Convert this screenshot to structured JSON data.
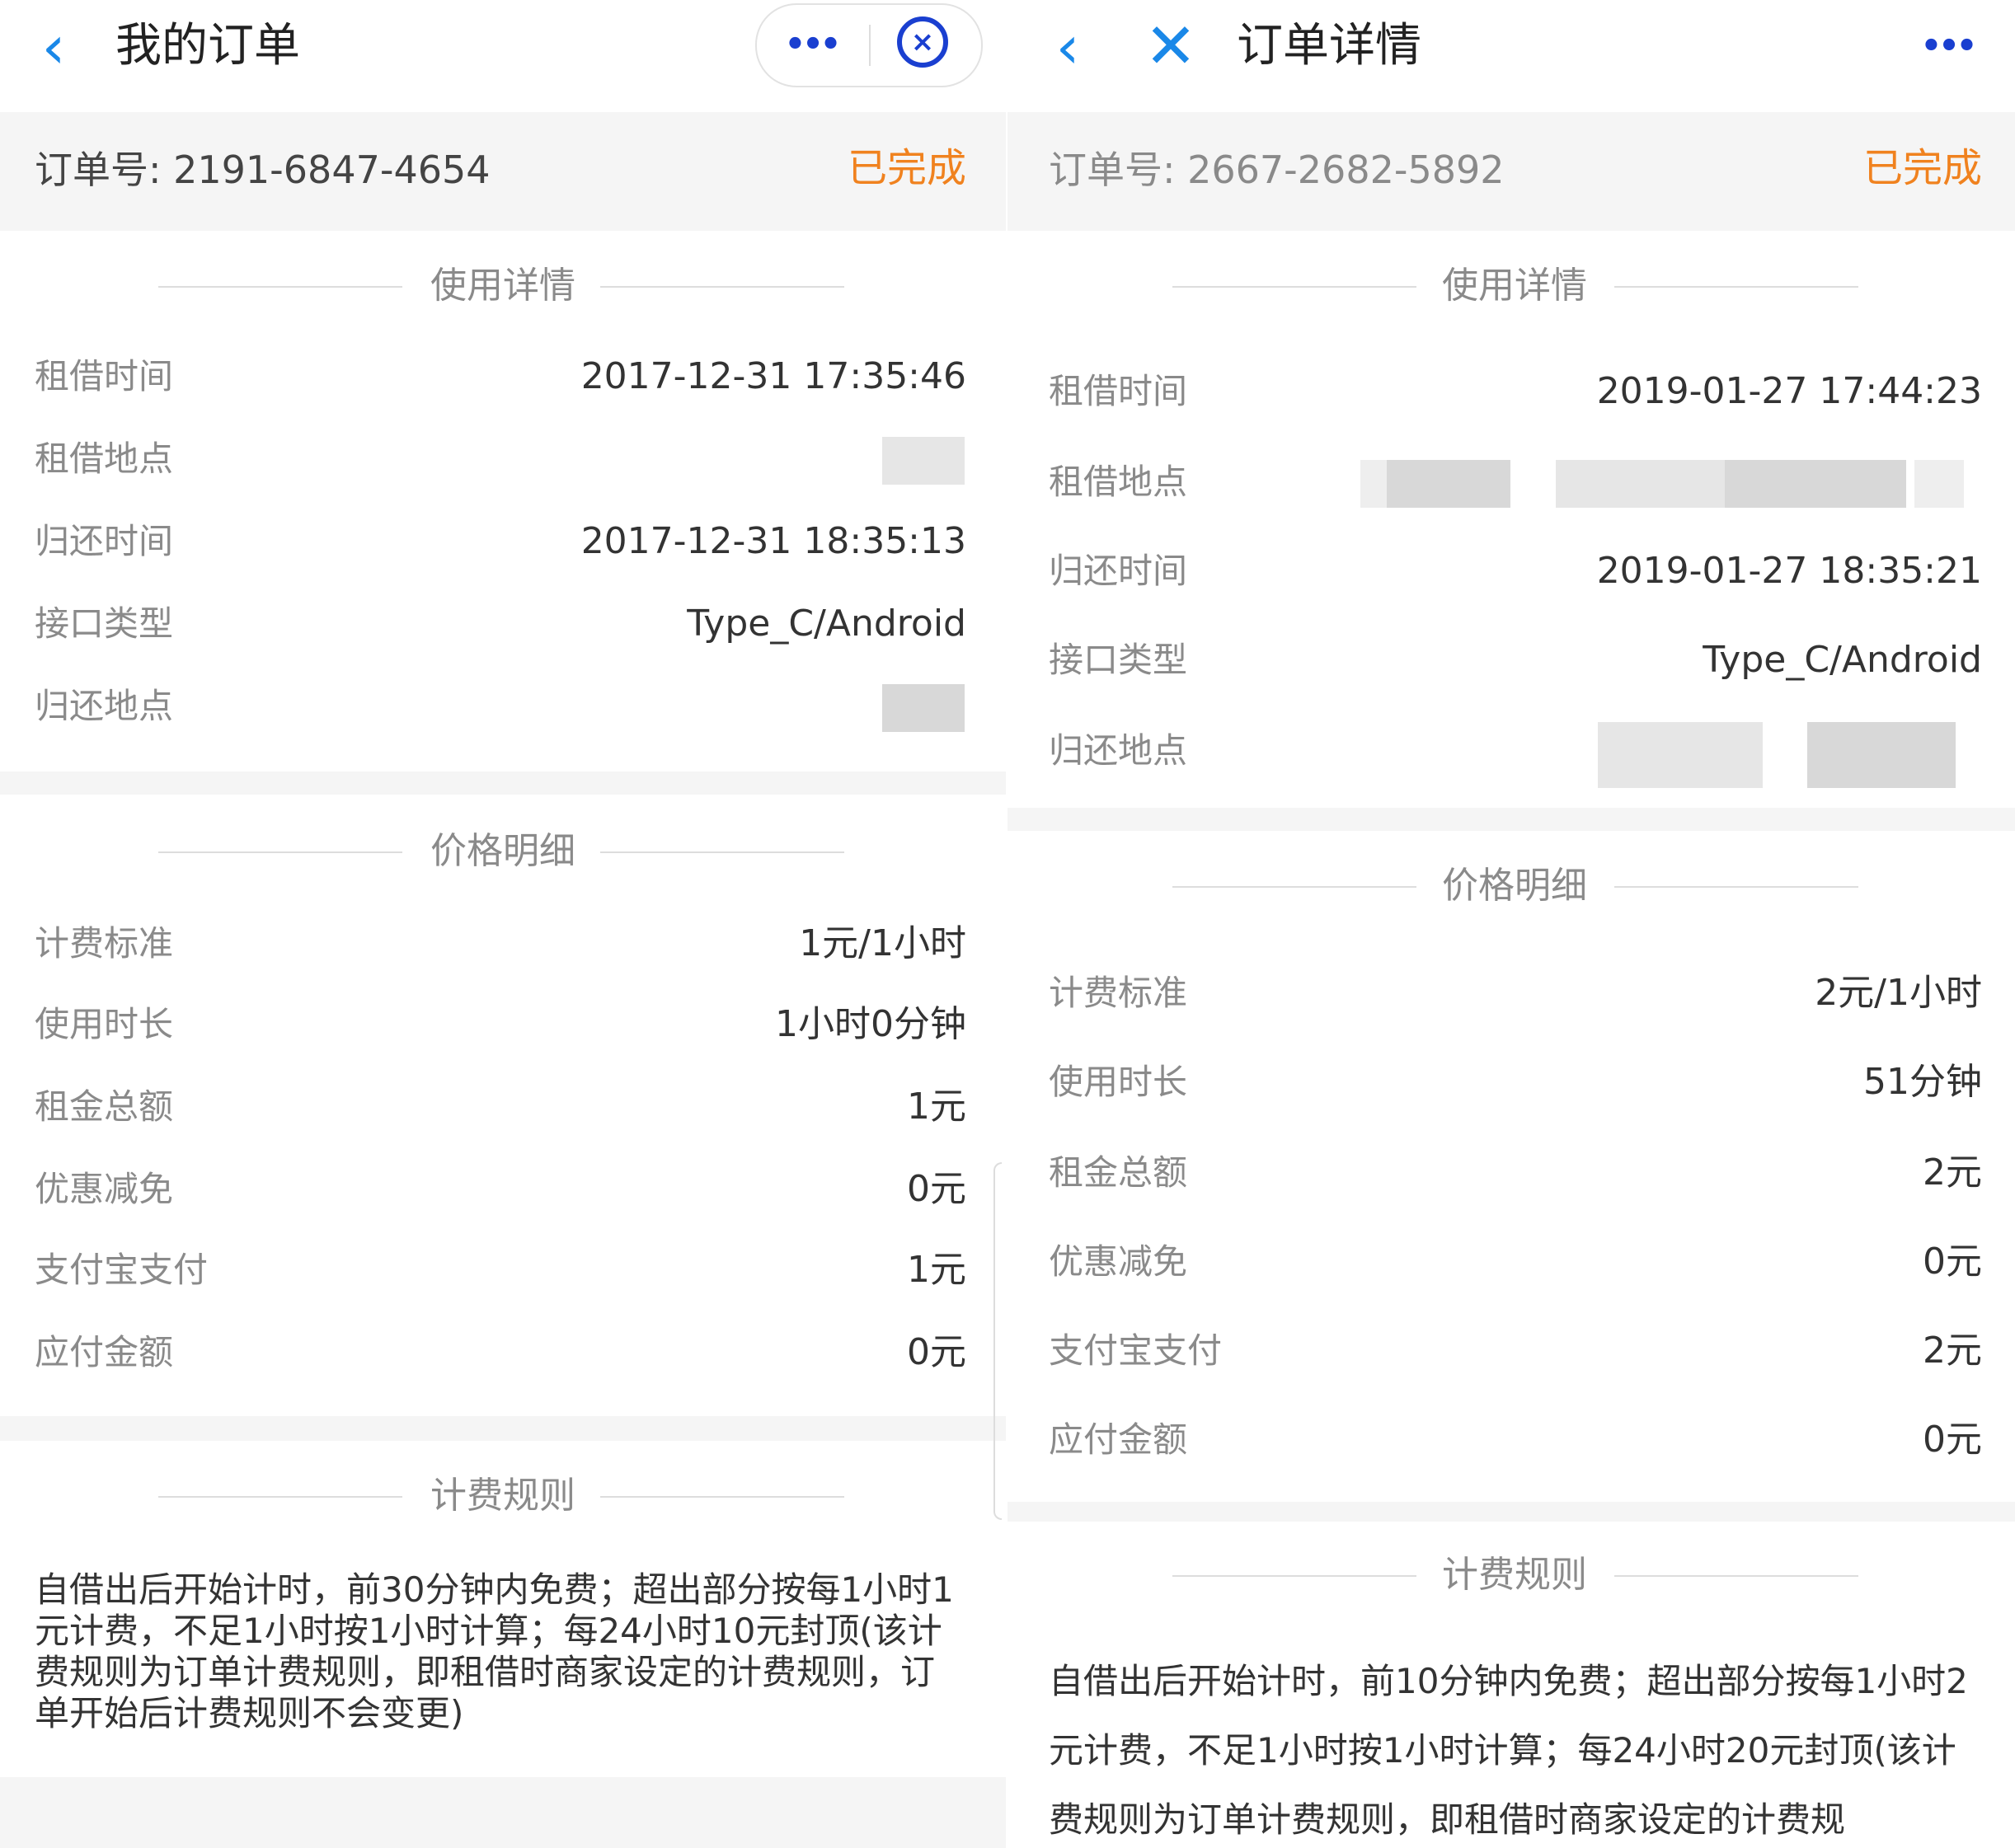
{
  "left": {
    "title": "我的订单",
    "back_icon": "chevron-left-icon",
    "more_icon": "more-dots-icon",
    "close_icon": "target-close-icon",
    "order_label": "订单号: 2191-6847-4654",
    "status": "已完成",
    "usage_title": "使用详情",
    "usage_rows": [
      {
        "label": "租借时间",
        "value": "2017-12-31 17:35:46"
      },
      {
        "label": "租借地点",
        "value": ""
      },
      {
        "label": "归还时间",
        "value": "2017-12-31 18:35:13"
      },
      {
        "label": "接口类型",
        "value": "Type_C/Android"
      },
      {
        "label": "归还地点",
        "value": ""
      }
    ],
    "price_title": "价格明细",
    "price_rows": [
      {
        "label": "计费标准",
        "value": "1元/1小时"
      },
      {
        "label": "使用时长",
        "value": "1小时0分钟"
      },
      {
        "label": "租金总额",
        "value": "1元"
      },
      {
        "label": "优惠减免",
        "value": "0元"
      },
      {
        "label": "支付宝支付",
        "value": "1元"
      },
      {
        "label": "应付金额",
        "value": "0元"
      }
    ],
    "rules_title": "计费规则",
    "rules_text": "自借出后开始计时，前30分钟内免费；超出部分按每1小时1元计费，不足1小时按1小时计算；每24小时10元封顶(该计费规则为订单计费规则，即租借时商家设定的计费规则，订单开始后计费规则不会变更)"
  },
  "right": {
    "title": "订单详情",
    "back_icon": "chevron-left-icon",
    "close_icon": "close-icon",
    "more_icon": "more-dots-icon",
    "order_label": "订单号: 2667-2682-5892",
    "status": "已完成",
    "usage_title": "使用详情",
    "usage_rows": [
      {
        "label": "租借时间",
        "value": "2019-01-27 17:44:23"
      },
      {
        "label": "租借地点",
        "value": ""
      },
      {
        "label": "归还时间",
        "value": "2019-01-27 18:35:21"
      },
      {
        "label": "接口类型",
        "value": "Type_C/Android"
      },
      {
        "label": "归还地点",
        "value": ""
      }
    ],
    "price_title": "价格明细",
    "price_rows": [
      {
        "label": "计费标准",
        "value": "2元/1小时"
      },
      {
        "label": "使用时长",
        "value": "51分钟"
      },
      {
        "label": "租金总额",
        "value": "2元"
      },
      {
        "label": "优惠减免",
        "value": "0元"
      },
      {
        "label": "支付宝支付",
        "value": "2元"
      },
      {
        "label": "应付金额",
        "value": "0元"
      }
    ],
    "rules_title": "计费规则",
    "rules_text": "自借出后开始计时，前10分钟内免费；超出部分按每1小时2元计费，不足1小时按1小时计算；每24小时20元封顶(该计费规则为订单计费规则，即租借时商家设定的计费规"
  },
  "colors": {
    "accent": "#1a88e8",
    "status": "#f0821f",
    "label": "#8a8a8a",
    "value": "#333333",
    "divider_bg": "#f5f5f5"
  }
}
